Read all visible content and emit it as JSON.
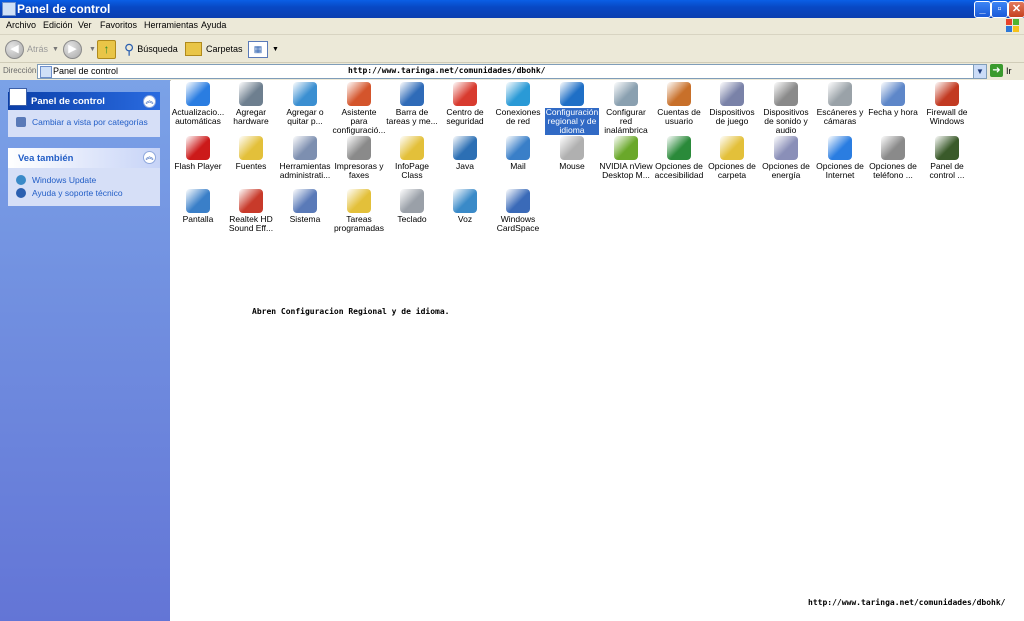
{
  "window": {
    "title": "Panel de control"
  },
  "menu": [
    "Archivo",
    "Edición",
    "Ver",
    "Favoritos",
    "Herramientas",
    "Ayuda"
  ],
  "toolbar": {
    "back": "Atrás",
    "search": "Búsqueda",
    "folders": "Carpetas"
  },
  "address": {
    "label": "Dirección",
    "value": "Panel de control",
    "go": "Ir"
  },
  "watermark_top": "http://www.taringa.net/comunidades/dbohk/",
  "watermark_bottom": "http://www.taringa.net/comunidades/dbohk/",
  "sidebar": {
    "panel1": {
      "title": "Panel de control",
      "link": "Cambiar a vista por categorías"
    },
    "panel2": {
      "title": "Vea también",
      "links": [
        "Windows Update",
        "Ayuda y soporte técnico"
      ]
    }
  },
  "caption": "Abren Configuracion Regional y de idioma.",
  "items": [
    {
      "label": "Actualizacio... automáticas",
      "color": "#2a7de1",
      "icon": "automatic-updates-icon"
    },
    {
      "label": "Agregar hardware",
      "color": "#6e7f8f",
      "icon": "add-hardware-icon"
    },
    {
      "label": "Agregar o quitar p...",
      "color": "#3b8fd1",
      "icon": "add-remove-programs-icon"
    },
    {
      "label": "Asistente para configuració...",
      "color": "#d4552c",
      "icon": "network-setup-icon"
    },
    {
      "label": "Barra de tareas y me...",
      "color": "#2f6bb8",
      "icon": "taskbar-icon"
    },
    {
      "label": "Centro de seguridad",
      "color": "#d83b2f",
      "icon": "security-center-icon"
    },
    {
      "label": "Conexiones de red",
      "color": "#2a9ad6",
      "icon": "network-connections-icon"
    },
    {
      "label": "Configuración regional y de idioma",
      "color": "#1f6fc6",
      "icon": "regional-language-icon"
    },
    {
      "label": "Configurar red inalámbrica",
      "color": "#8aa0b0",
      "icon": "wireless-network-icon"
    },
    {
      "label": "Cuentas de usuario",
      "color": "#c8702a",
      "icon": "user-accounts-icon"
    },
    {
      "label": "Dispositivos de juego",
      "color": "#7a82a8",
      "icon": "game-controllers-icon"
    },
    {
      "label": "Dispositivos de sonido y audio",
      "color": "#8a8a8a",
      "icon": "sound-audio-icon"
    },
    {
      "label": "Escáneres y cámaras",
      "color": "#9aa2a8",
      "icon": "scanners-cameras-icon"
    },
    {
      "label": "Fecha y hora",
      "color": "#5e87c9",
      "icon": "date-time-icon"
    },
    {
      "label": "Firewall de Windows",
      "color": "#c23a22",
      "icon": "firewall-icon"
    },
    {
      "label": "Flash Player",
      "color": "#cc1a1a",
      "icon": "flash-player-icon"
    },
    {
      "label": "Fuentes",
      "color": "#e3c03a",
      "icon": "fonts-icon"
    },
    {
      "label": "Herramientas administrati...",
      "color": "#7d8fb0",
      "icon": "admin-tools-icon"
    },
    {
      "label": "Impresoras y faxes",
      "color": "#8a8a8a",
      "icon": "printers-faxes-icon"
    },
    {
      "label": "InfoPage Class",
      "color": "#e3c03a",
      "icon": "folder-icon"
    },
    {
      "label": "Java",
      "color": "#2c6fb4",
      "icon": "java-icon"
    },
    {
      "label": "Mail",
      "color": "#3a7fc8",
      "icon": "mail-icon"
    },
    {
      "label": "Mouse",
      "color": "#b0b0b0",
      "icon": "mouse-icon"
    },
    {
      "label": "NVIDIA nView Desktop M...",
      "color": "#6aa82a",
      "icon": "nvidia-nview-icon"
    },
    {
      "label": "Opciones de accesibilidad",
      "color": "#2a8a3a",
      "icon": "accessibility-icon"
    },
    {
      "label": "Opciones de carpeta",
      "color": "#e3c03a",
      "icon": "folder-options-icon"
    },
    {
      "label": "Opciones de energía",
      "color": "#8a8fb8",
      "icon": "power-options-icon"
    },
    {
      "label": "Opciones de Internet",
      "color": "#2a7de1",
      "icon": "internet-options-icon"
    },
    {
      "label": "Opciones de teléfono ...",
      "color": "#8a8a8a",
      "icon": "phone-modem-icon"
    },
    {
      "label": "Panel de control ...",
      "color": "#3a5a2a",
      "icon": "nvidia-control-panel-icon"
    },
    {
      "label": "Pantalla",
      "color": "#3a7fc8",
      "icon": "display-icon"
    },
    {
      "label": "Realtek HD Sound Eff...",
      "color": "#c83a2a",
      "icon": "realtek-sound-icon"
    },
    {
      "label": "Sistema",
      "color": "#5a7ab8",
      "icon": "system-icon"
    },
    {
      "label": "Tareas programadas",
      "color": "#e3c03a",
      "icon": "scheduled-tasks-icon"
    },
    {
      "label": "Teclado",
      "color": "#9aa0a8",
      "icon": "keyboard-icon"
    },
    {
      "label": "Voz",
      "color": "#3a8ac8",
      "icon": "speech-icon"
    },
    {
      "label": "Windows CardSpace",
      "color": "#3a6ab8",
      "icon": "cardspace-icon"
    }
  ],
  "selected_item": 7
}
